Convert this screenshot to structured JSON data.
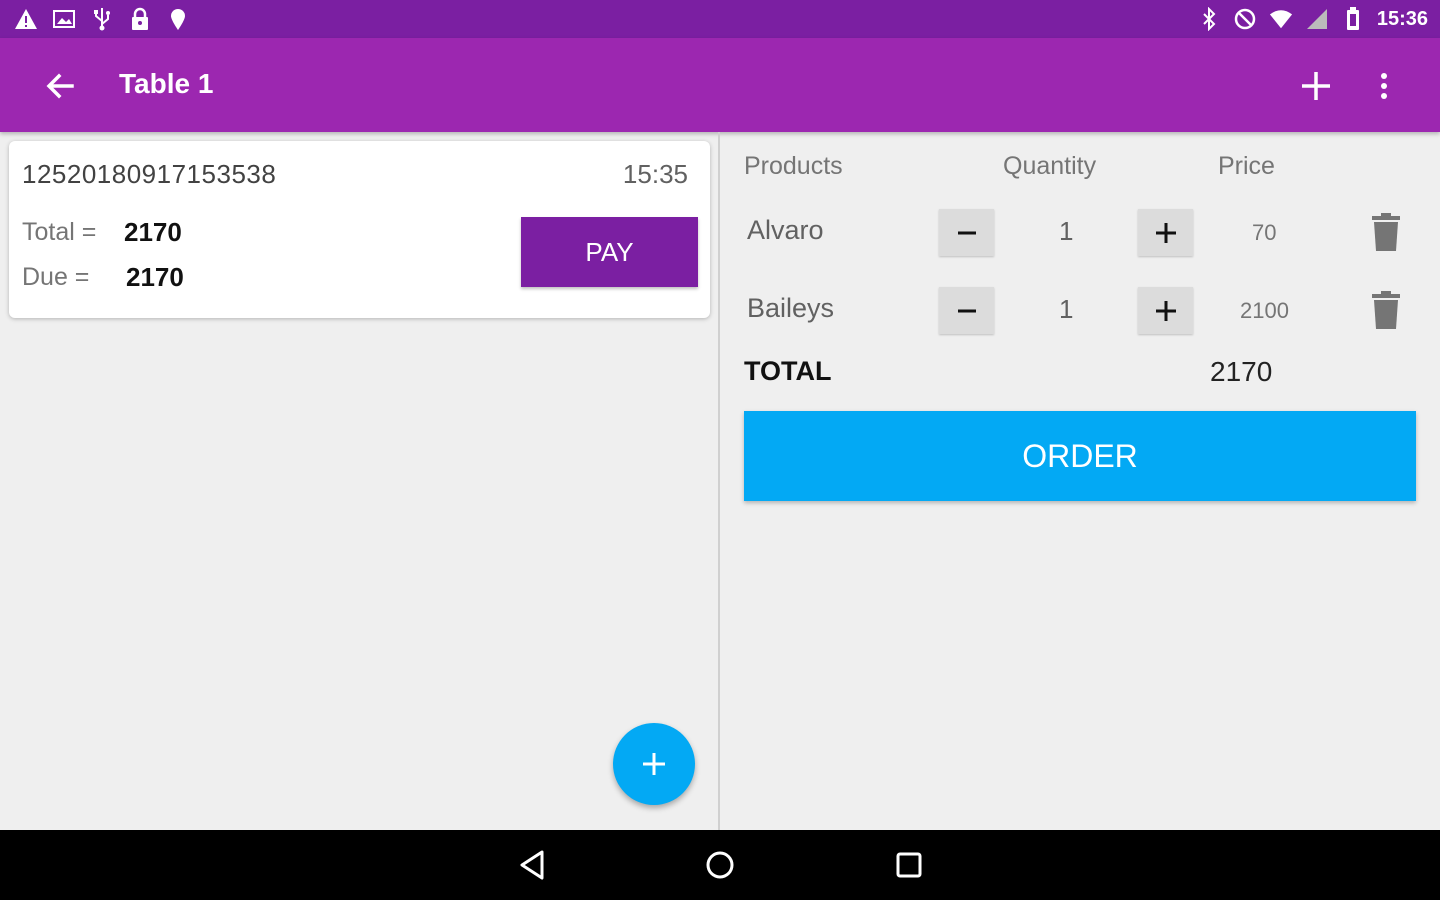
{
  "status_bar": {
    "time": "15:36",
    "left_icons": [
      "warning-icon",
      "image-icon",
      "usb-icon",
      "lock-icon",
      "location-icon"
    ],
    "right_icons": [
      "bluetooth-icon",
      "do-not-disturb-icon",
      "wifi-icon",
      "no-signal-icon",
      "battery-icon"
    ]
  },
  "app_bar": {
    "title": "Table 1",
    "back_icon": "arrow-back-icon",
    "add_icon": "plus-icon",
    "menu_icon": "more-vert-icon"
  },
  "order_card": {
    "order_id": "12520180917153538",
    "time": "15:35",
    "total_label": "Total  =",
    "total_value": "2170",
    "due_label": "Due  =",
    "due_value": "2170",
    "pay_label": "PAY"
  },
  "cart": {
    "headers": {
      "products": "Products",
      "quantity": "Quantity",
      "price": "Price"
    },
    "items": [
      {
        "name": "Alvaro",
        "quantity": "1",
        "price": "70"
      },
      {
        "name": "Baileys",
        "quantity": "1",
        "price": "2100"
      }
    ],
    "total_label": "TOTAL",
    "total_value": "2170",
    "order_label": "ORDER"
  },
  "colors": {
    "status_bar": "#7b1fa2",
    "app_bar": "#9c27b0",
    "pay_button": "#7b1fa2",
    "accent": "#03a9f4"
  },
  "nav_bar": {
    "icons": [
      "back-triangle-icon",
      "home-circle-icon",
      "recents-square-icon"
    ]
  }
}
